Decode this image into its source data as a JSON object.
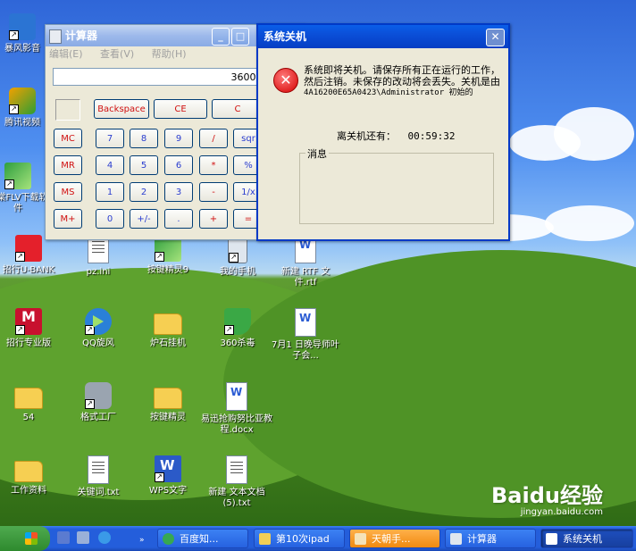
{
  "desktop": {
    "icons": [
      {
        "label": "暴风影音",
        "name": "icon-baofeng"
      },
      {
        "label": "腾讯视频",
        "name": "icon-tencent-video"
      },
      {
        "label": "维棠FLV下载软件",
        "name": "icon-flv-downloader"
      },
      {
        "label": "招行U-BANK",
        "name": "icon-cmb-ubank"
      },
      {
        "label": "pz.ini",
        "name": "icon-pz-ini"
      },
      {
        "label": "按键精灵9",
        "name": "icon-anjian9"
      },
      {
        "label": "我的手机",
        "name": "icon-my-phone"
      },
      {
        "label": "新建 RTF 文件.rtf",
        "name": "icon-new-rtf"
      },
      {
        "label": "招行专业版",
        "name": "icon-cmb-pro"
      },
      {
        "label": "QQ旋风",
        "name": "icon-qq-xuanfeng"
      },
      {
        "label": "炉石挂机",
        "name": "icon-hearthstone"
      },
      {
        "label": "360杀毒",
        "name": "icon-360"
      },
      {
        "label": "7月1 日晚导师叶子会...",
        "name": "icon-doc-july"
      },
      {
        "label": "54",
        "name": "icon-folder-54"
      },
      {
        "label": "格式工厂",
        "name": "icon-format-factory"
      },
      {
        "label": "按键精灵",
        "name": "icon-anjian-folder"
      },
      {
        "label": "易迅抢购努比亚教程.docx",
        "name": "icon-docx-tutorial"
      },
      {
        "label": "工作资料",
        "name": "icon-work-folder"
      },
      {
        "label": "关键词.txt",
        "name": "icon-keywords-txt"
      },
      {
        "label": "WPS文字",
        "name": "icon-wps"
      },
      {
        "label": "新建 文本文档 (5).txt",
        "name": "icon-new-txt5"
      }
    ]
  },
  "calculator": {
    "title": "计算器",
    "menu": [
      "编辑(E)",
      "查看(V)",
      "帮助(H)"
    ],
    "display": "3600.",
    "buttons": {
      "backspace": "Backspace",
      "ce": "CE",
      "c": "C",
      "mc": "MC",
      "mr": "MR",
      "ms": "MS",
      "mplus": "M+",
      "n7": "7",
      "n8": "8",
      "n9": "9",
      "div": "/",
      "sqrt": "sqr",
      "n4": "4",
      "n5": "5",
      "n6": "6",
      "mul": "*",
      "pct": "%",
      "n1": "1",
      "n2": "2",
      "n3": "3",
      "sub": "-",
      "inv": "1/x",
      "n0": "0",
      "sign": "+/-",
      "dot": ".",
      "add": "+",
      "eq": "="
    }
  },
  "shutdown": {
    "title": "系统关机",
    "message_line1": "系统即将关机。请保存所有正在运行的工作，然后注销。未保存的改动将会丢失。关机是由",
    "message_line2": "4A16200E65A0423\\Administrator 初始的",
    "countdown_label": "离关机还有：",
    "countdown_value": "00:59:32",
    "message_group": "消息"
  },
  "taskbar": {
    "tasks": [
      {
        "label": "百度知...",
        "name": "task-baidu-zhidao"
      },
      {
        "label": "第10次ipad",
        "name": "task-ipad10"
      },
      {
        "label": "天朝手...",
        "name": "task-tianchao"
      },
      {
        "label": "计算器",
        "name": "task-calculator"
      },
      {
        "label": "系统关机",
        "name": "task-shutdown"
      }
    ]
  },
  "watermark": {
    "brand": "Baidu经验",
    "url": "jingyan.baidu.com"
  }
}
